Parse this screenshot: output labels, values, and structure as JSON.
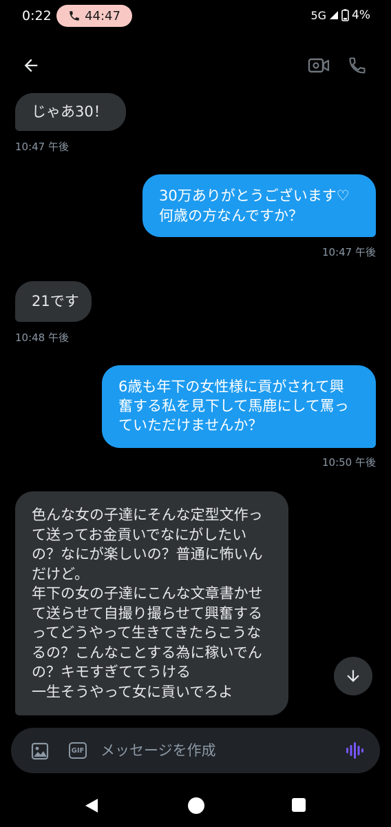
{
  "status_bar": {
    "time": "0:22",
    "call_timer": "44:47",
    "network": "5G",
    "battery": "4%"
  },
  "conversation": {
    "messages": [
      {
        "direction": "incoming",
        "text": "じゃあ30！",
        "time": "10:47 午後"
      },
      {
        "direction": "outgoing",
        "text": "30万ありがとうございます♡\n何歳の方なんですか？",
        "time": "10:47 午後"
      },
      {
        "direction": "incoming",
        "text": "21です",
        "time": "10:48 午後"
      },
      {
        "direction": "outgoing",
        "text": "6歳も年下の女性様に貢がされて興\n奮する私を見下して馬鹿にして罵っ\nていただけませんか？",
        "time": "10:50 午後"
      },
      {
        "direction": "incoming",
        "text": "色んな女の子達にそんな定型文作っ\nて送ってお金貢いでなにがしたい\nの？なにが楽しいの？普通に怖いん\nだけど。\n年下の女の子達にこんな文章書かせ\nて送らせて自撮り撮らせて興奮する\nってどうやって生きてきたらこうな\nるの？こんなことする為に稼いでん\nの？キモすぎててうける\n一生そうやって女に貢いでろよ"
      }
    ]
  },
  "composer": {
    "placeholder": "メッセージを作成",
    "gif_label": "GIF"
  },
  "icons": {
    "back": "arrow-left-icon",
    "video": "video-call-icon",
    "phone": "phone-icon",
    "scroll_down": "arrow-down-icon",
    "image": "image-icon",
    "voice": "voice-wave-icon"
  },
  "colors": {
    "background": "#000000",
    "incoming_bubble": "#2f3336",
    "outgoing_bubble": "#1d9bf0",
    "call_pill": "#f8c9c4",
    "voice_accent": "#7856ff"
  }
}
